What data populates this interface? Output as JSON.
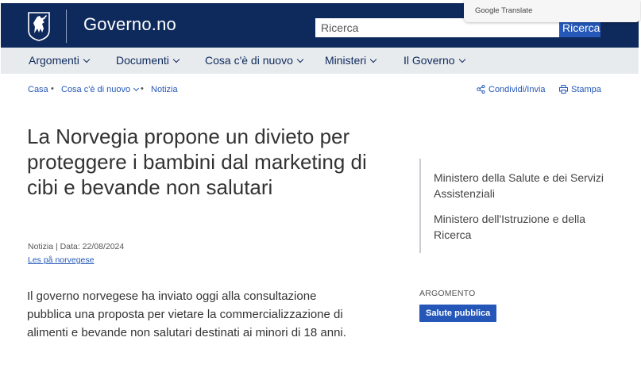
{
  "header": {
    "brand": "Governo.no",
    "search_placeholder": "Ricerca",
    "search_button": "Ricerca",
    "google_translate": "Google Translate",
    "colors": {
      "header_bg": "#0e2a5c",
      "accent": "#2457b8"
    }
  },
  "nav": {
    "items": [
      {
        "label": "Argomenti"
      },
      {
        "label": "Documenti"
      },
      {
        "label": "Cosa c'è di nuovo"
      },
      {
        "label": "Ministeri"
      },
      {
        "label": "Il Governo"
      }
    ]
  },
  "breadcrumb": {
    "items": [
      "Casa",
      "Cosa c'è di nuovo",
      "Notizia"
    ],
    "separator": "•"
  },
  "tools": {
    "share": "Condividi/Invia",
    "print": "Stampa"
  },
  "article": {
    "title": "La Norvegia propone un divieto per proteggere i bambini dal marketing di cibi e bevande non salutari",
    "meta": "Notizia | Data: 22/08/2024",
    "norwegian_link": "Les på norvegese",
    "lead": "Il governo norvegese ha inviato oggi alla consultazione pubblica una proposta per vietare la commercializzazione di alimenti e bevande non salutari destinati ai minori di 18 anni."
  },
  "sidebar": {
    "ministries": [
      "Ministero della Salute e dei Servizi Assistenziali",
      "Ministero dell'Istruzione e della Ricerca"
    ],
    "topic_label": "ARGOMENTO",
    "topic_tag": "Salute pubblica"
  }
}
